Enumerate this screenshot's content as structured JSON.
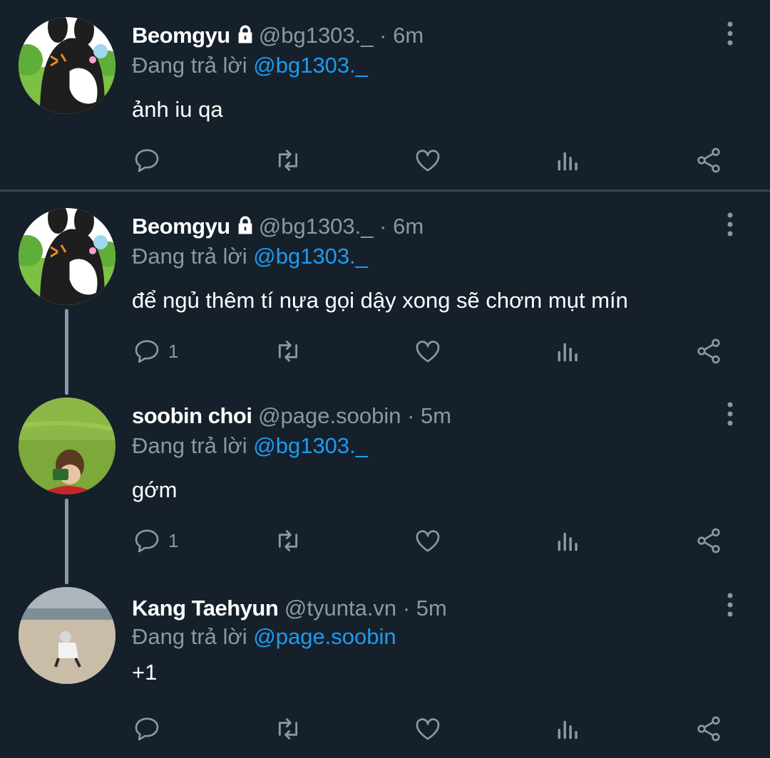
{
  "tweets": [
    {
      "name": "Beomgyu",
      "handle": "@bg1303._",
      "sep": "·",
      "time": "6m",
      "locked": true,
      "reply_prefix": "Đang trả lời",
      "reply_to": "@bg1303._",
      "text": "ảnh iu qa",
      "reply_count": "",
      "avatar": "cartoon"
    },
    {
      "name": "Beomgyu",
      "handle": "@bg1303._",
      "sep": "·",
      "time": "6m",
      "locked": true,
      "reply_prefix": "Đang trả lời",
      "reply_to": "@bg1303._",
      "text": "để ngủ thêm tí nựa gọi dậy xong sẽ chơm mụt mín",
      "reply_count": "1",
      "avatar": "cartoon"
    },
    {
      "name": "soobin choi",
      "handle": "@page.soobin",
      "sep": "·",
      "time": "5m",
      "locked": false,
      "reply_prefix": "Đang trả lời",
      "reply_to": "@bg1303._",
      "text": "gớm",
      "reply_count": "1",
      "avatar": "grass"
    },
    {
      "name": "Kang Taehyun",
      "handle": "@tyunta.vn",
      "sep": "·",
      "time": "5m",
      "locked": false,
      "reply_prefix": "Đang trả lời",
      "reply_to": "@page.soobin",
      "text": "+1",
      "reply_count": "",
      "avatar": "beach"
    }
  ],
  "icons": {
    "reply": "speech-bubble-icon",
    "retweet": "retweet-icon",
    "like": "heart-icon",
    "analytics": "bar-chart-icon",
    "share": "share-icon",
    "more": "vertical-dots-icon",
    "lock": "lock-icon"
  },
  "colors": {
    "background": "#15202b",
    "secondary_text": "#8899a6",
    "link": "#1d9bf0",
    "divider": "#38444d"
  }
}
